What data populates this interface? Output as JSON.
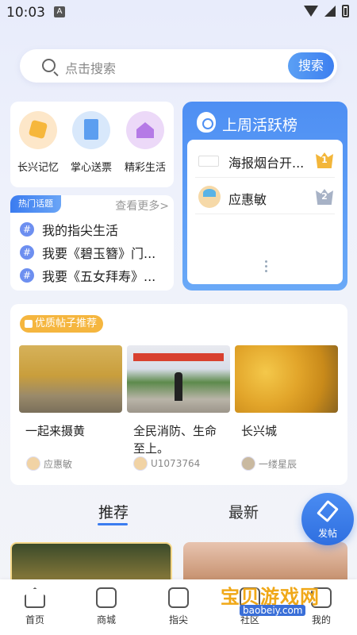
{
  "status_bar": {
    "time": "10:03",
    "notification_letter": "A"
  },
  "search": {
    "placeholder": "点击搜索",
    "button_label": "搜索"
  },
  "quick_links": [
    {
      "label": "长兴记忆",
      "icon": "memory-icon"
    },
    {
      "label": "掌心送票",
      "icon": "ticket-icon"
    },
    {
      "label": "精彩生活",
      "icon": "house-heart-icon"
    }
  ],
  "hot_topics": {
    "tag": "热门话题",
    "more": "查看更多>",
    "items": [
      "我的指尖生活",
      "我要《碧玉簪》门...",
      "我要《五女拜寿》..."
    ]
  },
  "ranking": {
    "title": "上周活跃榜",
    "entries": [
      {
        "name": "海报烟台开...",
        "rank": "1"
      },
      {
        "name": "应惠敏",
        "rank": "2"
      }
    ]
  },
  "featured_posts": {
    "tag": "优质帖子推荐",
    "items": [
      {
        "title": "一起来摄黄",
        "author": "应惠敏"
      },
      {
        "title": "全民消防、生命至上。",
        "author": "U1073764"
      },
      {
        "title": "长兴城",
        "author": "一缕星辰"
      }
    ]
  },
  "feed_tabs": {
    "active": "推荐",
    "other": "最新"
  },
  "fab": {
    "label": "发帖"
  },
  "bottom_nav": [
    {
      "label": "首页",
      "icon": "home-icon"
    },
    {
      "label": "商城",
      "icon": "shop-bag-icon"
    },
    {
      "label": "指尖",
      "icon": "fingertip-icon"
    },
    {
      "label": "社区",
      "icon": "community-icon"
    },
    {
      "label": "我的",
      "icon": "profile-icon"
    }
  ],
  "watermark": {
    "title": "宝贝游戏网",
    "url": "baobeiy.com"
  }
}
